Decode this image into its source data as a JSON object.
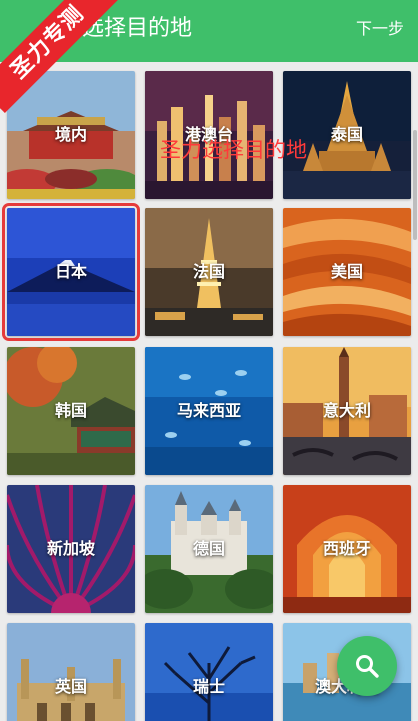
{
  "header": {
    "title": "选择目的地",
    "next_label": "下一步"
  },
  "watermark": {
    "ribbon_text": "圣力专测",
    "annotation": "圣力选择目的地"
  },
  "destinations": [
    {
      "label": "境内"
    },
    {
      "label": "港澳台"
    },
    {
      "label": "泰国"
    },
    {
      "label": "日本",
      "selected": true
    },
    {
      "label": "法国"
    },
    {
      "label": "美国"
    },
    {
      "label": "韩国"
    },
    {
      "label": "马来西亚"
    },
    {
      "label": "意大利"
    },
    {
      "label": "新加坡"
    },
    {
      "label": "德国"
    },
    {
      "label": "西班牙"
    },
    {
      "label": "英国"
    },
    {
      "label": "瑞士"
    },
    {
      "label": "澳大利亚"
    }
  ],
  "fab": {
    "icon": "search-icon"
  },
  "colors": {
    "accent": "#3fbf6a",
    "selection": "#e53b3b",
    "ribbon": "#e8262c"
  }
}
